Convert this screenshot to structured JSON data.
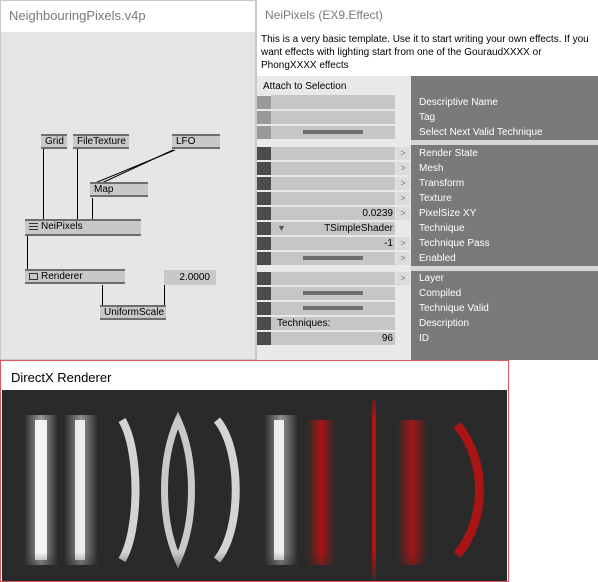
{
  "patch": {
    "title": "NeighbouringPixels.v4p",
    "nodes": {
      "grid": "Grid",
      "filetexture": "FileTexture",
      "lfo": "LFO",
      "map": "Map",
      "neipixels": "NeiPixels",
      "renderer": "Renderer",
      "uniformscale": "UniformScale",
      "scale_value": "2.0000"
    }
  },
  "inspector": {
    "title": "NeiPixels (EX9.Effect)",
    "description": "This is a very basic template. Use it to start writing your own effects. If you want effects with lighting start from one of the GouraudXXXX or PhongXXXX effects",
    "attach_label": "Attach to Selection",
    "pins": [
      {
        "name": "Descriptive Name",
        "value": ""
      },
      {
        "name": "Tag",
        "value": ""
      },
      {
        "name": "Select Next Valid Technique",
        "value": ""
      },
      {
        "name": "Render State",
        "value": ""
      },
      {
        "name": "Mesh",
        "value": ""
      },
      {
        "name": "Transform",
        "value": ""
      },
      {
        "name": "Texture",
        "value": ""
      },
      {
        "name": "PixelSize XY",
        "value": "0.0239"
      },
      {
        "name": "Technique",
        "value": "TSimpleShader"
      },
      {
        "name": "Technique Pass",
        "value": "-1"
      },
      {
        "name": "Enabled",
        "value": ""
      },
      {
        "name": "Layer",
        "value": ""
      },
      {
        "name": "Compiled",
        "value": ""
      },
      {
        "name": "Technique Valid",
        "value": ""
      },
      {
        "name": "Description",
        "value": "Techniques:"
      },
      {
        "name": "ID",
        "value": "96"
      }
    ],
    "arrow_glyph": ">"
  },
  "renderer": {
    "title": "DirectX Renderer",
    "colors": {
      "background": "#2a2a2a",
      "white": "#ffffff",
      "red": "#c01010"
    }
  }
}
